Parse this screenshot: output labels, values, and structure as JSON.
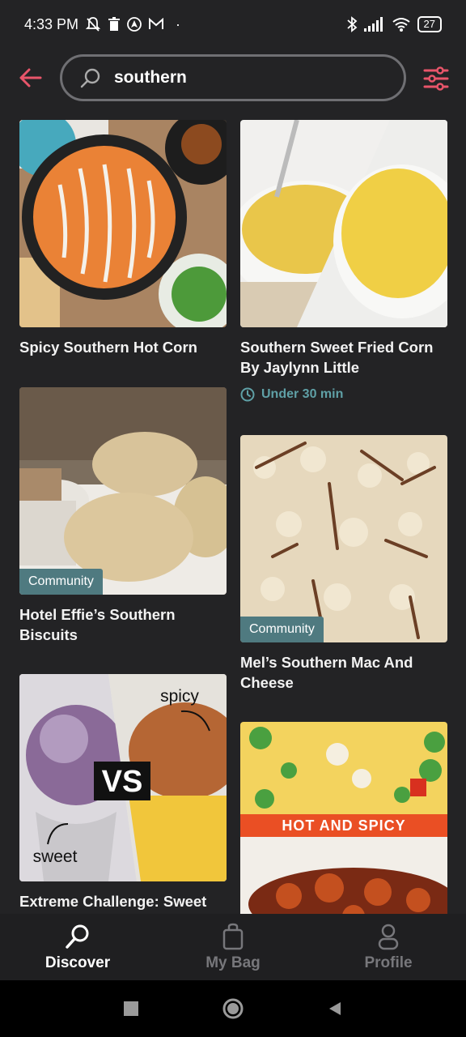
{
  "status_bar": {
    "time": "4:33 PM",
    "dot": "·",
    "battery": "27"
  },
  "search": {
    "value": "southern",
    "placeholder": "Search"
  },
  "colors": {
    "accent": "#e8556a",
    "teal": "#5fa0a6",
    "badge": "#4f7a80",
    "background": "#232325",
    "hot_banner": "#ea4f24"
  },
  "results": [
    {
      "title": "Spicy Southern Hot Corn",
      "image": "skillet-hot-corn"
    },
    {
      "title": "Southern Sweet Fried Corn By Jaylynn Little",
      "meta": "Under 30 min",
      "image": "fried-corn-bowls"
    },
    {
      "title": "Hotel Effie’s Southern Biscuits",
      "badge": "Community",
      "image": "biscuits"
    },
    {
      "title": "Mel’s Southern Mac And Cheese",
      "badge": "Community",
      "image": "mac-and-cheese"
    },
    {
      "title": "Extreme Challenge: Sweet",
      "image": "sweet-vs-spicy",
      "overlay": {
        "vs": "VS",
        "spicy": "spicy",
        "sweet": "sweet"
      }
    },
    {
      "title": "",
      "image": "hot-and-spicy-rice",
      "overlay": {
        "banner": "HOT AND SPICY"
      }
    }
  ],
  "bottom_nav": [
    {
      "label": "Discover",
      "icon": "search-icon",
      "active": true
    },
    {
      "label": "My Bag",
      "icon": "bag-icon",
      "active": false
    },
    {
      "label": "Profile",
      "icon": "person-icon",
      "active": false
    }
  ]
}
